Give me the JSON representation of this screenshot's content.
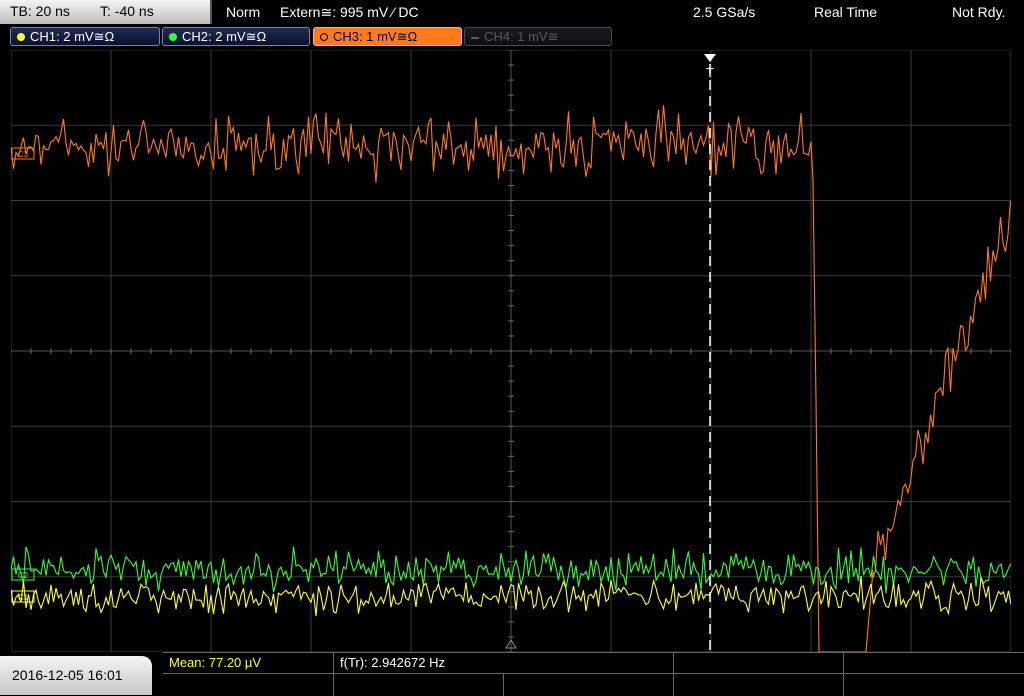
{
  "header": {
    "timebase": "TB: 20 ns",
    "trigger_time": "T: -40 ns",
    "mode": "Norm",
    "trigger_source": "Extern≅: 995 mV ⁄ DC",
    "sample_rate": "2.5 GSa/s",
    "acq_mode": "Real Time",
    "status": "Not Rdy."
  },
  "channels": [
    {
      "label": "CH1: 2 mV≅Ω",
      "color": "#ffff33",
      "state": "on"
    },
    {
      "label": "CH2: 2 mV≅Ω",
      "color": "#33ff33",
      "state": "on"
    },
    {
      "label": "CH3: 1 mV≅Ω",
      "color": "#ff7a1a",
      "state": "active"
    },
    {
      "label": "CH4: 1 mV≅",
      "color": "#5a5a5a",
      "state": "off"
    }
  ],
  "markers": {
    "ch3": "C3",
    "ch2": "C2",
    "ch1": "C1",
    "trigger": "T"
  },
  "footer": {
    "datetime": "2016-12-05 16:01",
    "measurement_1": "Mean: 77.20 µV",
    "measurement_1_color": "#ffff33",
    "measurement_2": "f(Tr): 2.942672 Hz"
  },
  "colors": {
    "ch1": "#ffff33",
    "ch2": "#33ff33",
    "ch3": "#ff7a1a",
    "grid": "#3a3a3a"
  }
}
